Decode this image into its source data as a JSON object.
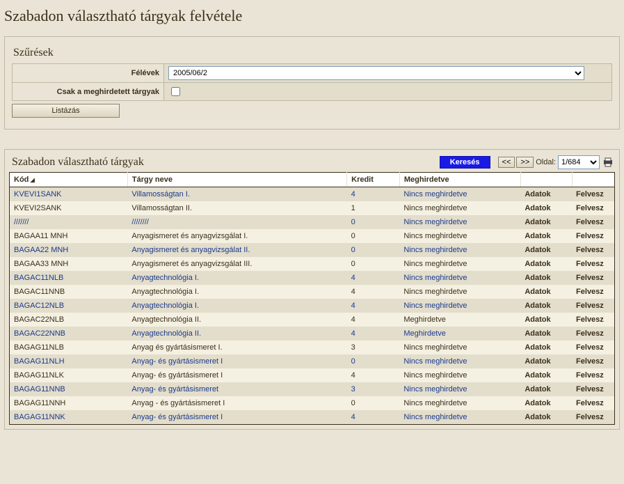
{
  "page": {
    "title": "Szabadon választható tárgyak felvétele"
  },
  "filters": {
    "panel_title": "Szűrések",
    "semester_label": "Félévek",
    "semester_value": "2005/06/2",
    "only_announced_label": "Csak a meghirdetett tárgyak",
    "only_announced_checked": false,
    "list_button": "Listázás"
  },
  "results": {
    "title": "Szabadon választható tárgyak",
    "search_button": "Keresés",
    "prev": "<<",
    "next": ">>",
    "page_label": "Oldal:",
    "page_value": "1/684",
    "headers": {
      "code": "Kód",
      "name": "Tárgy neve",
      "credit": "Kredit",
      "status": "Meghirdetve"
    },
    "action_adatok": "Adatok",
    "action_felvesz": "Felvesz",
    "rows": [
      {
        "code": "KVEVI1SANK",
        "name": "Villamosságtan I.",
        "credit": "4",
        "status": "Nincs meghirdetve",
        "link": true,
        "status_link": true
      },
      {
        "code": "KVEVI2SANK",
        "name": "Villamosságtan II.",
        "credit": "1",
        "status": "Nincs meghirdetve",
        "link": false,
        "status_link": false
      },
      {
        "code": "///////",
        "name": "////////",
        "credit": "0",
        "status": "Nincs meghirdetve",
        "link": true,
        "status_link": true
      },
      {
        "code": "BAGAA11 MNH",
        "name": "Anyagismeret és anyagvizsgálat I.",
        "credit": "0",
        "status": "Nincs meghirdetve",
        "link": false,
        "status_link": false
      },
      {
        "code": "BAGAA22 MNH",
        "name": "Anyagismeret és anyagvizsgálat II.",
        "credit": "0",
        "status": "Nincs meghirdetve",
        "link": true,
        "status_link": true
      },
      {
        "code": "BAGAA33 MNH",
        "name": "Anyagismeret és anyagvizsgálat III.",
        "credit": "0",
        "status": "Nincs meghirdetve",
        "link": false,
        "status_link": false
      },
      {
        "code": "BAGAC11NLB",
        "name": "Anyagtechnológia I.",
        "credit": "4",
        "status": "Nincs meghirdetve",
        "link": true,
        "status_link": true
      },
      {
        "code": "BAGAC11NNB",
        "name": "Anyagtechnológia I.",
        "credit": "4",
        "status": "Nincs meghirdetve",
        "link": false,
        "status_link": false
      },
      {
        "code": "BAGAC12NLB",
        "name": "Anyagtechnológia I.",
        "credit": "4",
        "status": "Nincs meghirdetve",
        "link": true,
        "status_link": true
      },
      {
        "code": "BAGAC22NLB",
        "name": "Anyagtechnológia II.",
        "credit": "4",
        "status": "Meghirdetve",
        "link": false,
        "status_link": false
      },
      {
        "code": "BAGAC22NNB",
        "name": "Anyagtechnológia II.",
        "credit": "4",
        "status": "Meghirdetve",
        "link": true,
        "status_link": true
      },
      {
        "code": "BAGAG11NLB",
        "name": "Anyag és gyártásismeret I.",
        "credit": "3",
        "status": "Nincs meghirdetve",
        "link": false,
        "status_link": false
      },
      {
        "code": "BAGAG11NLH",
        "name": "Anyag- és gyártásismeret I",
        "credit": "0",
        "status": "Nincs meghirdetve",
        "link": true,
        "status_link": true
      },
      {
        "code": "BAGAG11NLK",
        "name": "Anyag- és gyártásismeret I",
        "credit": "4",
        "status": "Nincs meghirdetve",
        "link": false,
        "status_link": false
      },
      {
        "code": "BAGAG11NNB",
        "name": "Anyag- és gyártásismeret",
        "credit": "3",
        "status": "Nincs meghirdetve",
        "link": true,
        "status_link": true
      },
      {
        "code": "BAGAG11NNH",
        "name": "Anyag - és gyártásismeret I",
        "credit": "0",
        "status": "Nincs meghirdetve",
        "link": false,
        "status_link": false
      },
      {
        "code": "BAGAG11NNK",
        "name": "Anyag- és gyártásismeret I",
        "credit": "4",
        "status": "Nincs meghirdetve",
        "link": true,
        "status_link": true
      }
    ]
  }
}
